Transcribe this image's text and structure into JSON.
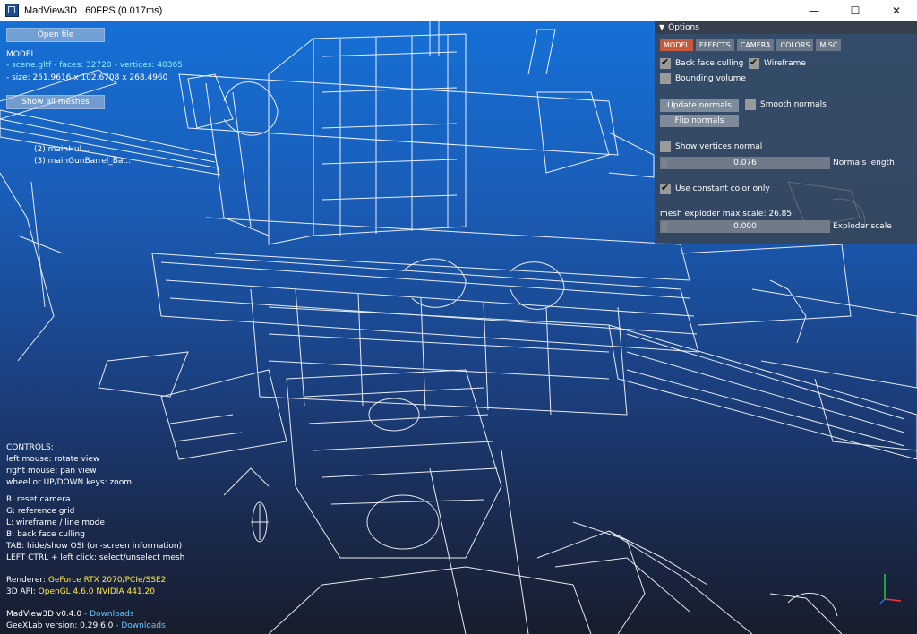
{
  "window": {
    "title": "MadView3D | 60FPS (0.017ms)",
    "minimize_glyph": "—",
    "maximize_glyph": "☐",
    "close_glyph": "✕"
  },
  "osi": {
    "open_file_label": "Open file",
    "model_heading": "MODEL",
    "model_file": "- scene.gltf",
    "model_faces": "- faces: 32720",
    "model_vertices": "- vertices: 40365",
    "model_size": "- size: 251.9616 x 102.6708 x 268.4960",
    "show_all_meshes_label": "Show all meshes",
    "mesh_items": [
      "(2) mainHul...",
      "(3) mainGunBarrel_Ba..."
    ],
    "controls": [
      "CONTROLS:",
      "left mouse: rotate view",
      "right mouse: pan view",
      "wheel or UP/DOWN keys: zoom"
    ],
    "keys": [
      "R: reset camera",
      "G: reference grid",
      "L: wireframe / line mode",
      "B: back face culling",
      "TAB: hide/show OSI (on-screen information)",
      "LEFT CTRL + left click: select/unselect mesh"
    ],
    "renderer_label": "Renderer:",
    "renderer_value": "GeForce RTX 2070/PCIe/SSE2",
    "api_label": "3D API:",
    "api_value": "OpenGL 4.6.0 NVIDIA 441.20",
    "version_text": "MadView3D v0.4.0",
    "version_link": "- Downloads",
    "geexlab_text": "GeeXLab version: 0.29.6.0",
    "geexlab_link": "- Downloads"
  },
  "options": {
    "header": "Options",
    "tabs": [
      "MODEL",
      "EFFECTS",
      "CAMERA",
      "COLORS",
      "MISC"
    ],
    "active_tab": "MODEL",
    "back_face_culling": "Back face culling",
    "wireframe": "Wireframe",
    "bounding_volume": "Bounding volume",
    "update_normals": "Update normals",
    "smooth_normals": "Smooth normals",
    "flip_normals": "Flip normals",
    "show_vertices_normal": "Show vertices normal",
    "normals_length_value": "0.076",
    "normals_length_label": "Normals length",
    "use_constant_color": "Use constant color only",
    "exploder_max_scale": "mesh exploder max scale: 26.85",
    "exploder_value": "0.000",
    "exploder_label": "Exploder scale",
    "checked": {
      "back_face_culling": true,
      "wireframe": true,
      "bounding_volume": false,
      "smooth_normals": false,
      "show_vertices_normal": false,
      "use_constant_color": true
    }
  },
  "colors": {
    "tab_active": "#c85a3c",
    "filename": "#8df0ff",
    "renderer": "#ffe94d",
    "link": "#66c4ff"
  }
}
